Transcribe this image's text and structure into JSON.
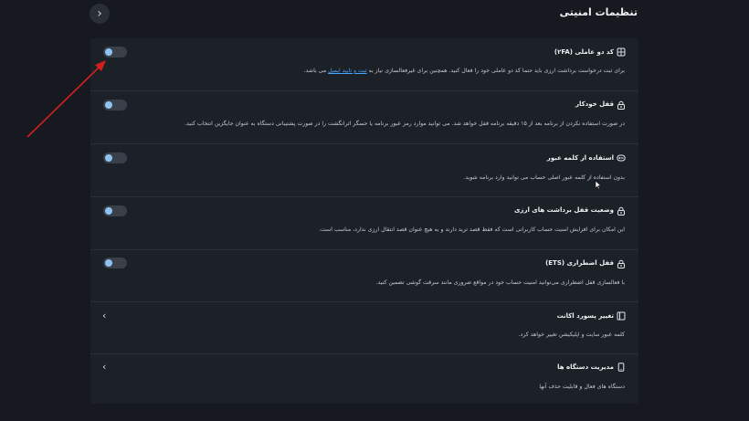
{
  "header": {
    "title": "تنظیمات امنیتی",
    "back_icon": "chevron-left-icon"
  },
  "settings": [
    {
      "title": "کد دو عاملی (۲FA)",
      "icon": "grid-shield-icon",
      "desc_before": "برای ثبت درخواست برداشت ارزی باید حتما کد دو عاملی خود را فعال کنید. همچنین برای غیرفعالسازی نیاز به ",
      "desc_link": "ثبت و تایید ایمیل",
      "desc_after": " می باشد.",
      "control": "toggle",
      "enabled": false
    },
    {
      "title": "قفل خودکار",
      "icon": "lock-icon",
      "desc": "در صورت استفاده نکردن از برنامه بعد از ۱۵ دقیقه برنامه قفل خواهد شد. می توانید موارد رمز عبور برنامه یا حسگر اثرانگشت را در صورت پشتیبانی دستگاه به عنوان جایگزین انتخاب کنید.",
      "control": "toggle",
      "enabled": false
    },
    {
      "title": "استفاده از کلمه عبور",
      "icon": "key-icon",
      "desc": "بدون استفاده از کلمه عبور اصلی حساب می توانید وارد برنامه شوید.",
      "control": "toggle",
      "enabled": false
    },
    {
      "title": "وضعیت قفل برداشت های ارزی",
      "icon": "lock-icon",
      "desc": "این امکان برای افزایش امنیت حساب کاربرانی است که فقط قصد ترید دارند و به هیچ عنوان قصد انتقال ارزی ندارد، مناسب است.",
      "control": "toggle",
      "enabled": false
    },
    {
      "title": "قفل اضطراری (ETS)",
      "icon": "lock-icon",
      "desc": "با فعالسازی قفل اضطراری می‌توانید امنیت حساب خود در مواقع ضروری مانند سرقت گوشی تضمین کنید.",
      "control": "toggle",
      "enabled": false
    },
    {
      "title": "تغییر پسورد اکانت",
      "icon": "book-icon",
      "desc": "کلمه عبور سایت و اپلیکیشن تغییر خواهد کرد.",
      "control": "chevron"
    },
    {
      "title": "مدیریت دستگاه ها",
      "icon": "phone-icon",
      "desc": "دستگاه های فعال و قابلیت حذف آنها",
      "control": "chevron"
    }
  ],
  "colors": {
    "background": "#161a20",
    "panel": "#1c2027",
    "toggle_knob": "#8fc4f2",
    "link": "#4aa3ff",
    "annotation_arrow": "#d11f1f"
  }
}
